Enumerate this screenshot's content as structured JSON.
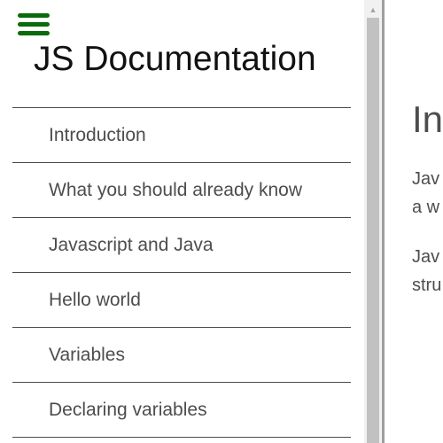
{
  "colors": {
    "hamburger": "#0a6b0a",
    "nav_text": "#4d4d4d",
    "nav_border": "#4a4a4a",
    "scroll_thumb": "#c1c1c1",
    "divider": "#9e9e9e"
  },
  "nav": {
    "menu_icon": "hamburger-menu-icon",
    "title": "JS Documentation",
    "items": [
      {
        "label": "Introduction"
      },
      {
        "label": "What you should already know"
      },
      {
        "label": "Javascript and Java"
      },
      {
        "label": "Hello world"
      },
      {
        "label": "Variables"
      },
      {
        "label": "Declaring variables"
      }
    ]
  },
  "main": {
    "section_title": "Int",
    "paragraphs": [
      {
        "line1": "Jav",
        "line2": "a w"
      },
      {
        "line1": "Jav",
        "line2": "stru"
      }
    ]
  }
}
